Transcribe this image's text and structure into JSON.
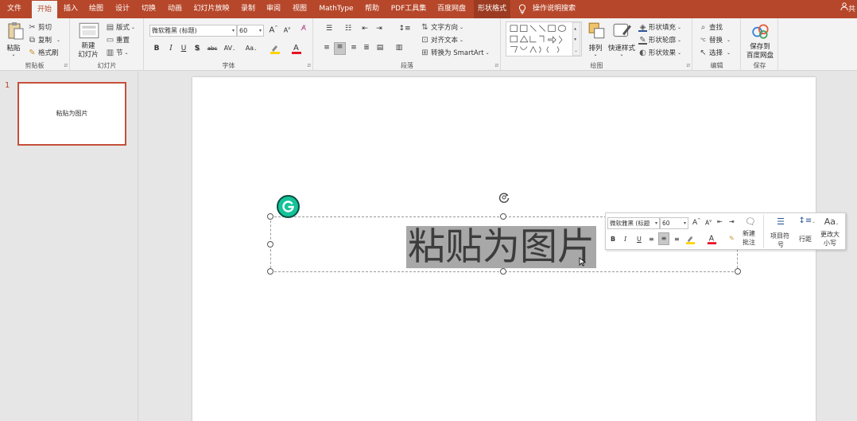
{
  "tabs": [
    {
      "label": "文件"
    },
    {
      "label": "开始"
    },
    {
      "label": "插入"
    },
    {
      "label": "绘图"
    },
    {
      "label": "设计"
    },
    {
      "label": "切换"
    },
    {
      "label": "动画"
    },
    {
      "label": "幻灯片放映"
    },
    {
      "label": "录制"
    },
    {
      "label": "审阅"
    },
    {
      "label": "视图"
    },
    {
      "label": "MathType"
    },
    {
      "label": "帮助"
    },
    {
      "label": "PDF工具集"
    },
    {
      "label": "百度网盘"
    },
    {
      "label": "形状格式"
    }
  ],
  "search_label": "操作说明搜索",
  "share_label": "共",
  "clipboard": {
    "paste": "粘贴",
    "cut": "剪切",
    "copy": "复制",
    "format_painter": "格式刷",
    "group": "剪贴板"
  },
  "slides": {
    "new_slide_l1": "新建",
    "new_slide_l2": "幻灯片",
    "layout": "版式",
    "reset": "重置",
    "section": "节",
    "group": "幻灯片"
  },
  "font": {
    "name": "微软雅黑 (标题)",
    "size": "60",
    "bold": "B",
    "italic": "I",
    "underline": "U",
    "shadow": "S",
    "strike": "abc",
    "spacing": "AV",
    "case": "Aa",
    "grow": "A",
    "shrink": "A",
    "group": "字体"
  },
  "paragraph": {
    "text_direction": "文字方向",
    "align_text": "对齐文本",
    "smartart": "转换为 SmartArt",
    "group": "段落"
  },
  "drawing": {
    "arrange": "排列",
    "quick_styles": "快速样式",
    "fill": "形状填充",
    "outline": "形状轮廓",
    "effects": "形状效果",
    "group": "绘图"
  },
  "editing": {
    "find": "查找",
    "replace": "替换",
    "select": "选择",
    "group": "编辑"
  },
  "save": {
    "l1": "保存到",
    "l2": "百度网盘",
    "group": "保存"
  },
  "thumbnail": {
    "number": "1",
    "text": "粘贴为图片"
  },
  "slide_text": "粘贴为图片",
  "minibar": {
    "font": "微软雅黑 (标题",
    "size": "60",
    "new_comment_l1": "新建",
    "new_comment_l2": "批注",
    "bullets_l1": "项目符",
    "bullets_l2": "号",
    "line_spacing": "行距",
    "change_case_l1": "更改大",
    "change_case_l2": "小写",
    "aa": "Aa"
  },
  "colors": {
    "accent": "#b7472a",
    "thumb_border": "#c5503a",
    "highlight": "#a8a8a8",
    "grammarly": "#15c39a"
  }
}
